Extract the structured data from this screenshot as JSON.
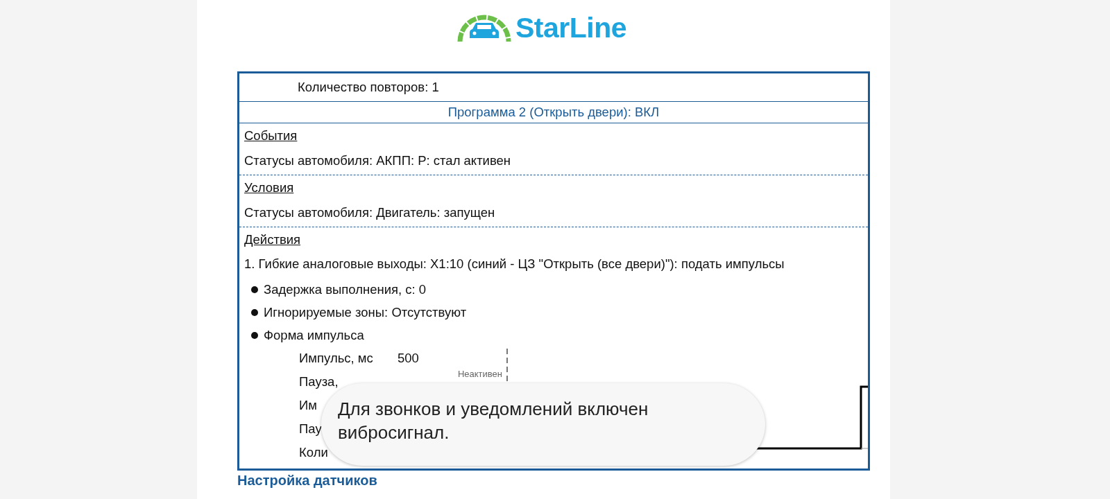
{
  "logo": {
    "text": "StarLine"
  },
  "repeat_row": "Количество повторов: 1",
  "program_title": "Программа 2 (Открыть двери): ВКЛ",
  "sections": [
    {
      "heading": "События",
      "lines": [
        "Статусы автомобиля: АКПП: P: стал активен"
      ]
    },
    {
      "heading": "Условия",
      "lines": [
        "Статусы автомобиля: Двигатель: запущен"
      ]
    },
    {
      "heading": "Действия",
      "lines": [
        "1. Гибкие аналоговые выходы: X1:10 (синий - ЦЗ \"Открыть (все двери)\"): подать импульсы"
      ],
      "bullets": [
        "Задержка выполнения, с: 0",
        "Игнорируемые зоны: Отсутствуют",
        "Форма импульса"
      ],
      "pulse_params": [
        {
          "label": "Импульс, мс",
          "value": "500"
        },
        {
          "label": "Пауза,"
        },
        {
          "label": "Им"
        },
        {
          "label": "Пау"
        },
        {
          "label": "Коли"
        }
      ],
      "pulse_chart": {
        "label": "Неактивен"
      }
    }
  ],
  "toast": {
    "text": "Для звонков и уведомлений включен вибросигнал."
  },
  "next_heading": "Настройка датчиков"
}
